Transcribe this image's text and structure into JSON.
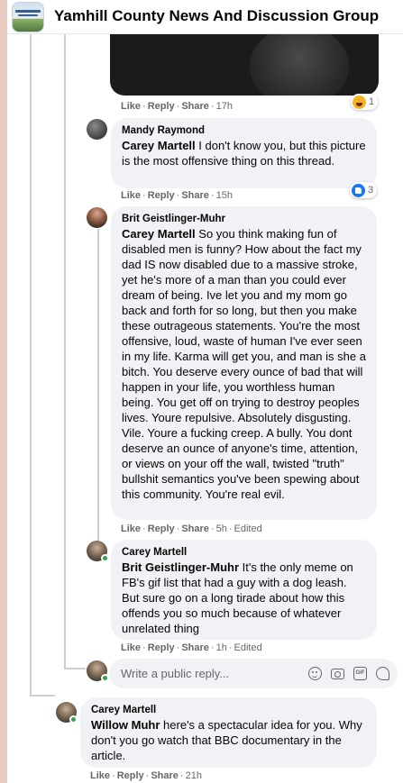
{
  "header": {
    "group_title": "Yamhill County News And Discussion Group",
    "group_icon": "group-cover-thumbnail"
  },
  "colors": {
    "left_bar": "#e9cdc2",
    "bubble_bg": "#f0f2f5",
    "meta_text": "#65676b",
    "online_dot": "#31a24c"
  },
  "top_comment": {
    "actions": {
      "like": "Like",
      "reply": "Reply",
      "share": "Share",
      "time": "17h"
    },
    "reaction": {
      "icon": "haha-reaction-icon",
      "count": "1"
    }
  },
  "comments": [
    {
      "author": "Mandy Raymond",
      "mention": "Carey Martell",
      "text": " I don't know you, but this picture is the most offensive thing on this thread.",
      "actions": {
        "like": "Like",
        "reply": "Reply",
        "share": "Share",
        "time": "15h",
        "edited": ""
      },
      "reaction": {
        "icon": "like-reaction-icon",
        "count": "3"
      }
    },
    {
      "author": "Brit Geistlinger-Muhr",
      "mention": "Carey Martell",
      "text": " So you think making fun of disabled men is funny? How about the fact my dad IS now disabled due to a massive stroke, yet he's more of a man than you could ever dream of being. Ive let you and my mom go back and forth for so long, but then you make these outrageous statements. You're the most offensive, loud, waste of human I've ever seen in my life. Karma will get you, and man is she a bitch. You deserve every ounce of bad that will happen in your life, you worthless human being. You get off on trying to destroy peoples lives. Youre repulsive. Absolutely disgusting. Vile. Youre a fucking creep. A bully. You dont deserve an ounce of anyone's time, attention, or views on your off the wall, twisted \"truth\" bullshit semantics you've been spewing about this community. You're real evil.",
      "actions": {
        "like": "Like",
        "reply": "Reply",
        "share": "Share",
        "time": "5h",
        "edited": "Edited"
      }
    },
    {
      "author": "Carey Martell",
      "mention": "Brit Geistlinger-Muhr",
      "text": " It's the only meme on FB's gif list that had a guy with a dog leash. But sure go on a long tirade about how this offends you so much because of whatever unrelated thing",
      "actions": {
        "like": "Like",
        "reply": "Reply",
        "share": "Share",
        "time": "1h",
        "edited": "Edited"
      }
    },
    {
      "author": "Carey Martell",
      "mention": "Willow Muhr",
      "text": " here's a spectacular idea for you. Why don't you go watch that BBC documentary in the article.",
      "actions": {
        "like": "Like",
        "reply": "Reply",
        "share": "Share",
        "time": "21h",
        "edited": ""
      }
    }
  ],
  "reply_box": {
    "placeholder": "Write a public reply...",
    "icons": [
      "emoji-icon",
      "camera-icon",
      "gif-icon",
      "sticker-icon"
    ]
  }
}
